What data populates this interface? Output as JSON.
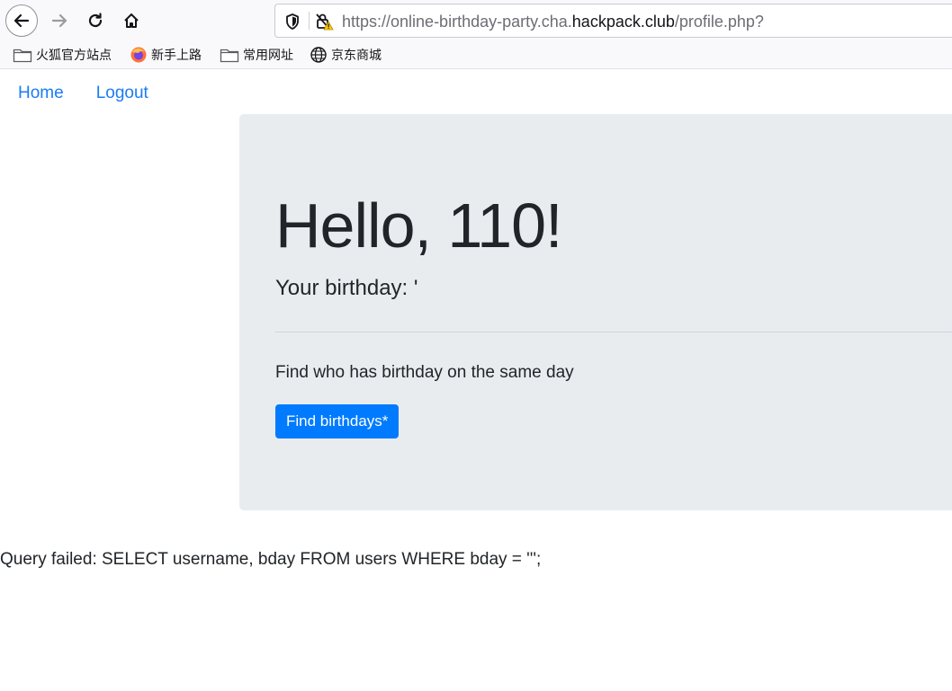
{
  "browser": {
    "url_prefix": "https://online-birthday-party.cha.",
    "url_domain": "hackpack.club",
    "url_suffix": "/profile.php?",
    "bookmarks": [
      {
        "label": "火狐官方站点",
        "icon": "folder-icon"
      },
      {
        "label": "新手上路",
        "icon": "firefox-icon"
      },
      {
        "label": "常用网址",
        "icon": "folder-icon"
      },
      {
        "label": "京东商城",
        "icon": "globe-icon"
      }
    ]
  },
  "page": {
    "nav": {
      "home": "Home",
      "logout": "Logout"
    },
    "greeting": "Hello, 110!",
    "birthday": "Your birthday: '",
    "find_text": "Find who has birthday on the same day",
    "find_button": "Find birthdays*",
    "query_error": "Query failed: SELECT username, bday FROM users WHERE bday = ''';"
  },
  "colors": {
    "link": "#1a7cf5",
    "button": "#007bff",
    "jumbotron_bg": "#e9ecef"
  }
}
